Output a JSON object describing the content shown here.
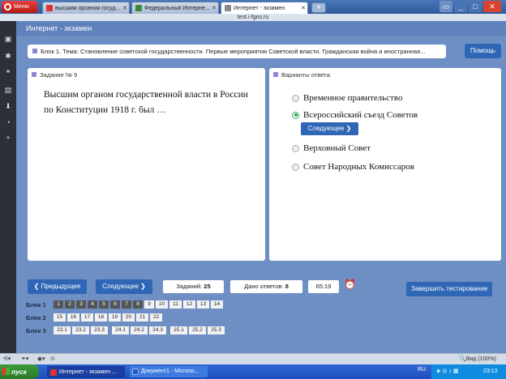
{
  "browser": {
    "menu_label": "Меню",
    "tabs": [
      {
        "title": "высшим органом госуд...",
        "active": false
      },
      {
        "title": "Федеральный Интерне...",
        "active": false
      },
      {
        "title": "Интернет - экзамен",
        "active": true
      }
    ],
    "new_tab_symbol": "+",
    "address": "test.i-fgos.ru",
    "window_controls": [
      "_",
      "□",
      "✕"
    ]
  },
  "page": {
    "header": "Интернет - экзамен",
    "topic": "Блок 1. Тема: Становление советской государственности. Первые мероприятия Советской власти. Гражданская война и иностранная...",
    "help_label": "Помощь",
    "question": {
      "title": "Задание № 9",
      "text": "Высшим органом государственной власти в России по Конституции 1918 г. был …"
    },
    "answers": {
      "title": "Варианты ответа:",
      "options": [
        {
          "label": "Временное правительство",
          "selected": false
        },
        {
          "label": "Всероссийский съезд Советов",
          "selected": true
        },
        {
          "label": "Верховный Совет",
          "selected": false
        },
        {
          "label": "Совет Народных Комиссаров",
          "selected": false
        }
      ],
      "next_inline_label": "Следующее ❯"
    },
    "nav": {
      "prev_label": "❮ Предыдущее",
      "next_label": "Следующее ❯",
      "tasks_label": "Заданий:",
      "tasks_value": "25",
      "answered_label": "Дано ответов:",
      "answered_value": "8",
      "timer": "65:19",
      "finish_label": "Завершить тестирование"
    },
    "blocks": [
      {
        "label": "Блок 1",
        "items": [
          "1",
          "2",
          "3",
          "4",
          "5",
          "6",
          "7",
          "8",
          "9",
          "10",
          "11",
          "12",
          "13",
          "14"
        ],
        "done_count": 8
      },
      {
        "label": "Блок 2",
        "items": [
          "15",
          "16",
          "17",
          "18",
          "19",
          "20",
          "21",
          "22"
        ],
        "done_count": 0
      },
      {
        "label": "Блок 3",
        "items": [
          "23.1",
          "23.2",
          "23.3",
          "24.1",
          "24.2",
          "24.3",
          "25.1",
          "25.2",
          "25.3"
        ],
        "done_count": 0
      }
    ]
  },
  "statusbar": {
    "zoom": "Вид (100%)"
  },
  "taskbar": {
    "start_label": "пуск",
    "tasks": [
      {
        "title": "Интернет - экзамен ..."
      },
      {
        "title": "Документ1 - Microso..."
      }
    ],
    "lang": "RU",
    "time": "23:13"
  },
  "colors": {
    "page_bg": "#6e8fc4",
    "button_blue": "#2f66b5",
    "taskbar_blue": "#1c4fbd",
    "start_green": "#2a7c2a"
  }
}
